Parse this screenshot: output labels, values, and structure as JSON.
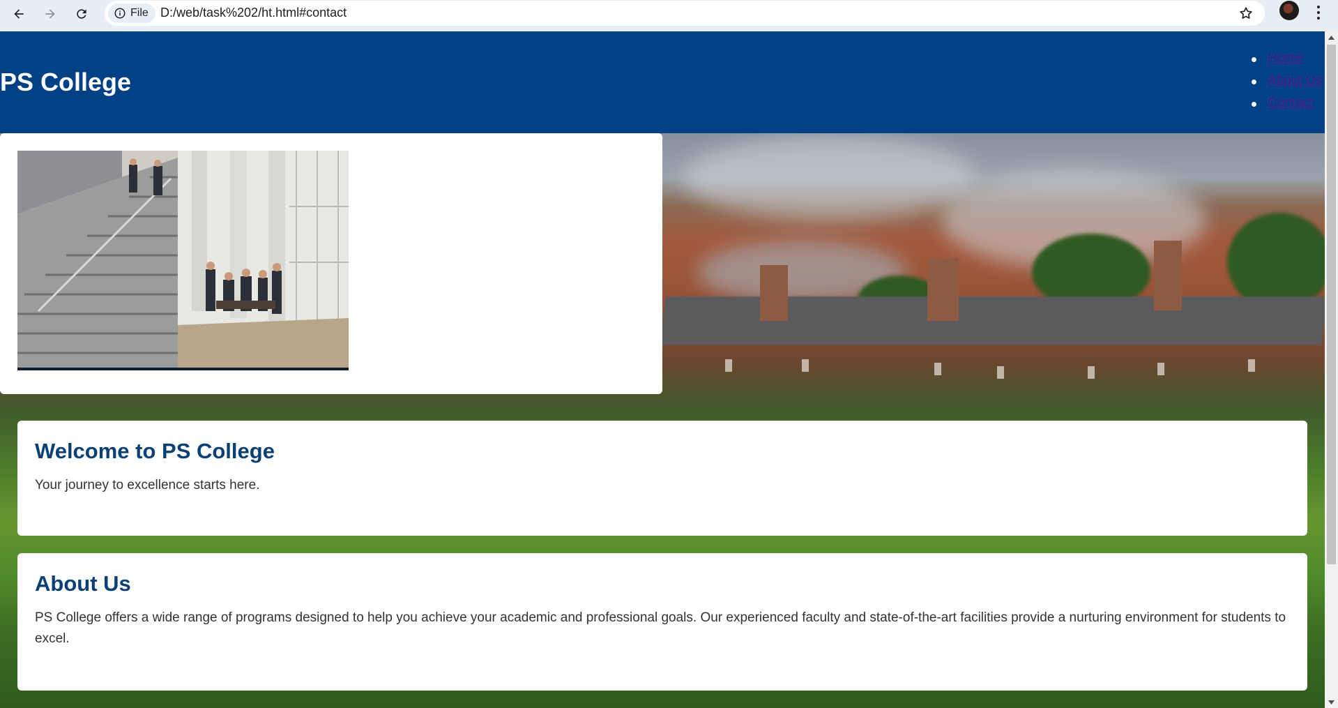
{
  "browser": {
    "chip_label": "File",
    "url": "D:/web/task%202/ht.html#contact",
    "icons": [
      "back-icon",
      "forward-icon",
      "reload-icon",
      "info-icon",
      "star-icon",
      "avatar",
      "more-icon"
    ]
  },
  "site": {
    "title": "PS College",
    "nav": [
      {
        "label": "Home"
      },
      {
        "label": "About Us"
      },
      {
        "label": "Contact"
      }
    ],
    "header_color": "#004085",
    "link_color": "#551a8b"
  },
  "sections": {
    "welcome": {
      "heading": "Welcome to PS College",
      "text": "Your journey to excellence starts here."
    },
    "about": {
      "heading": "About Us",
      "text": "PS College offers a wide range of programs designed to help you achieve your academic and professional goals. Our experienced faculty and state-of-the-art facilities provide a nurturing environment for students to excel."
    }
  },
  "heading_color": "#0b4077"
}
